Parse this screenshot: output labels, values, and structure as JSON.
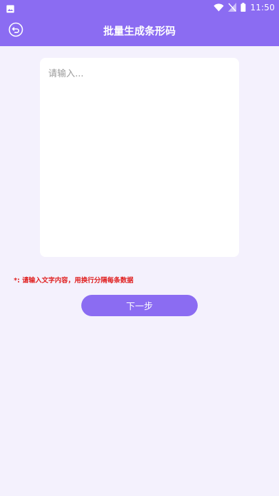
{
  "status": {
    "time": "11:50"
  },
  "toolbar": {
    "title": "批量生成条形码"
  },
  "input": {
    "placeholder": "请输入...",
    "value": ""
  },
  "hint": "*: 请输入文字内容，用换行分隔每条数据",
  "next_button": "下一步",
  "colors": {
    "accent": "#8b6cf2",
    "background": "#f4f1fd",
    "hint": "#e02020"
  },
  "icons": {
    "status_left": "image-icon",
    "wifi": "wifi-icon",
    "signal": "no-signal-icon",
    "battery": "battery-icon",
    "back": "back-icon"
  }
}
